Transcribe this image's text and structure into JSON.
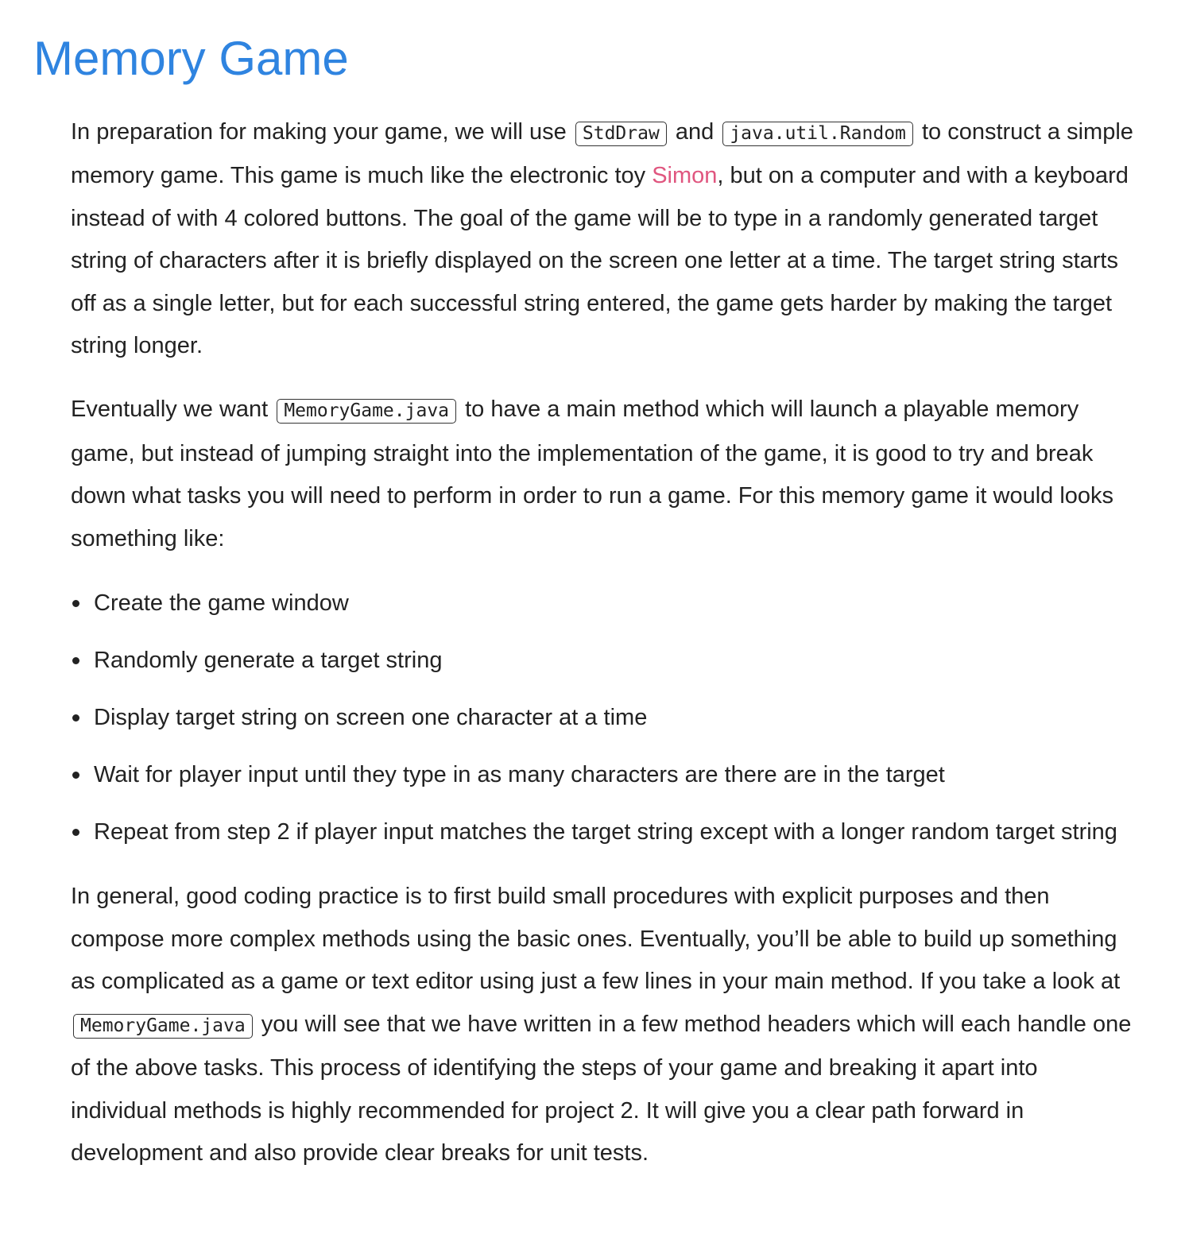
{
  "title": "Memory Game",
  "para1": {
    "t1": "In preparation for making your game, we will use",
    "code1": "StdDraw",
    "t2": "and",
    "code2": "java.util.Random",
    "t3": "to construct a simple memory game. This game is much like the electronic toy",
    "link": "Simon",
    "t4": ", but on a computer and with a keyboard instead of with 4 colored buttons. The goal of the game will be to type in a randomly generated target string of characters after it is briefly displayed on the screen one letter at a time. The target string starts off as a single letter, but for each successful string entered, the game gets harder by making the target string longer."
  },
  "para2": {
    "t1": "Eventually we want",
    "code1": "MemoryGame.java",
    "t2": "to have a main method which will launch a playable memory game, but instead of jumping straight into the implementation of the game, it is good to try and break down what tasks you will need to perform in order to run a game. For this memory game it would looks something like:"
  },
  "tasks": [
    "Create the game window",
    "Randomly generate a target string",
    "Display target string on screen one character at a time",
    "Wait for player input until they type in as many characters are there are in the target",
    "Repeat from step 2 if player input matches the target string except with a longer random target string"
  ],
  "para3": {
    "t1": "In general, good coding practice is to first build small procedures with explicit purposes and then compose more complex methods using the basic ones. Eventually, you’ll be able to build up something as complicated as a game or text editor using just a few lines in your main method. If you take a look at",
    "code1": "MemoryGame.java",
    "t2": "you will see that we have written in a few method headers which will each handle one of the above tasks. This process of identifying the steps of your game and breaking it apart into individual methods is highly recommended for project 2. It will give you a clear path forward in development and also provide clear breaks for unit tests."
  },
  "colors": {
    "title": "#2f84e0",
    "link": "#e0567f",
    "text": "#222222"
  }
}
